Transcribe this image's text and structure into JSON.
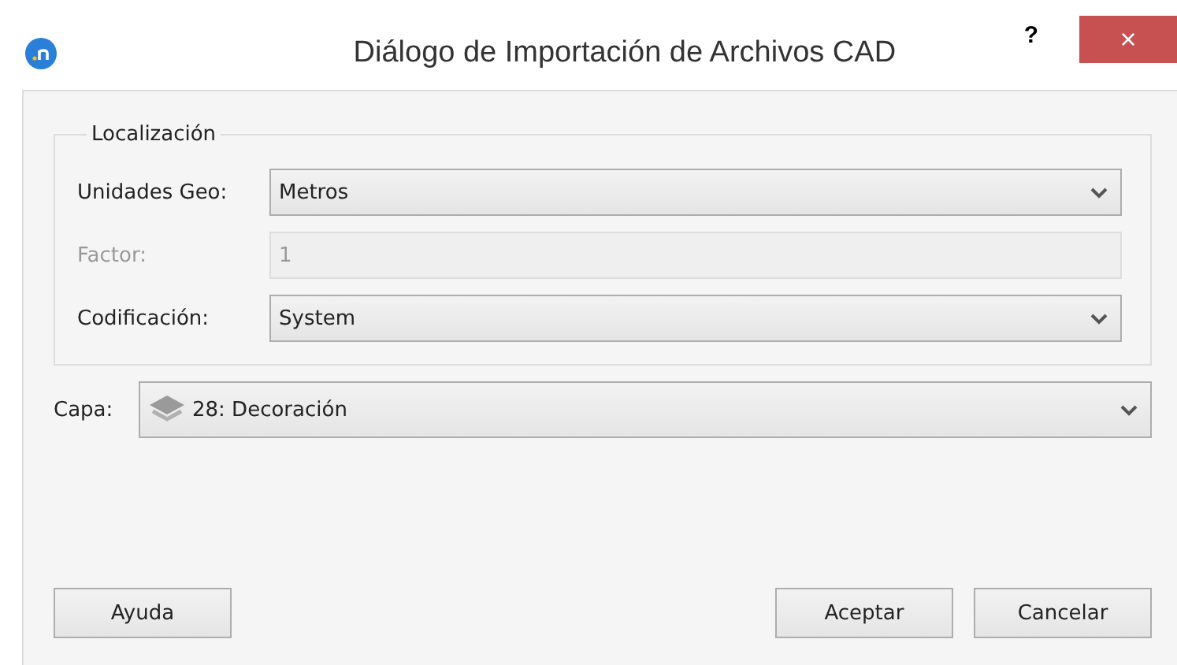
{
  "window": {
    "title": "Diálogo de Importación de Archivos CAD",
    "help": "?",
    "close": "×"
  },
  "group": {
    "title": "Localización",
    "fields": [
      {
        "kind": "combo",
        "label": "Unidades Geo:",
        "value": "Metros",
        "disabled": false
      },
      {
        "kind": "text",
        "label": "Factor:",
        "value": "1",
        "disabled": true
      },
      {
        "kind": "combo",
        "label": "Codificación:",
        "value": "System",
        "disabled": false
      }
    ]
  },
  "layer": {
    "label": "Capa:",
    "value": "28: Decoración"
  },
  "help_button": "Ayuda",
  "buttons": [
    "Aceptar",
    "Cancelar"
  ]
}
